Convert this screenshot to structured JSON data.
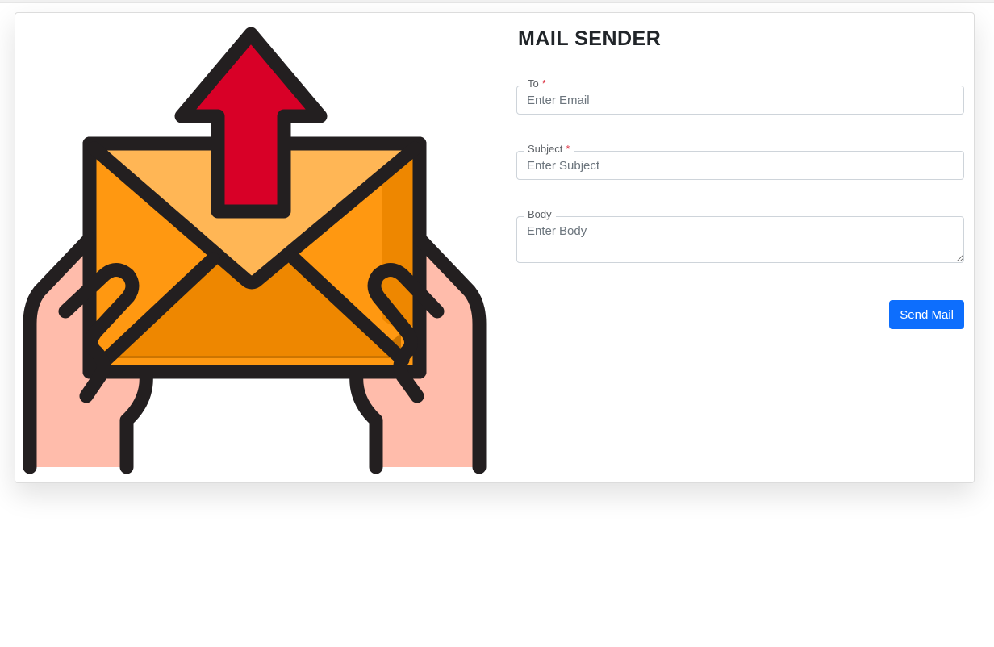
{
  "page": {
    "title": "MAIL SENDER"
  },
  "form": {
    "to": {
      "label": "To",
      "required_mark": "*",
      "placeholder": "Enter Email",
      "value": ""
    },
    "subject": {
      "label": "Subject",
      "required_mark": "*",
      "placeholder": "Enter Subject",
      "value": ""
    },
    "body": {
      "label": "Body",
      "placeholder": "Enter Body",
      "value": ""
    },
    "submit_label": "Send Mail"
  },
  "illustration": {
    "icon": "hands-holding-envelope-upload-icon",
    "colors": {
      "outline": "#231f20",
      "arrow": "#d80027",
      "envelope_light": "#ffb655",
      "envelope_mid": "#ff9811",
      "envelope_dark": "#ee8700",
      "envelope_shade": "#cc7400",
      "hands": "#ffbcab"
    }
  },
  "colors": {
    "primary": "#0d6efd",
    "required": "#dc3545",
    "text": "#212529"
  }
}
